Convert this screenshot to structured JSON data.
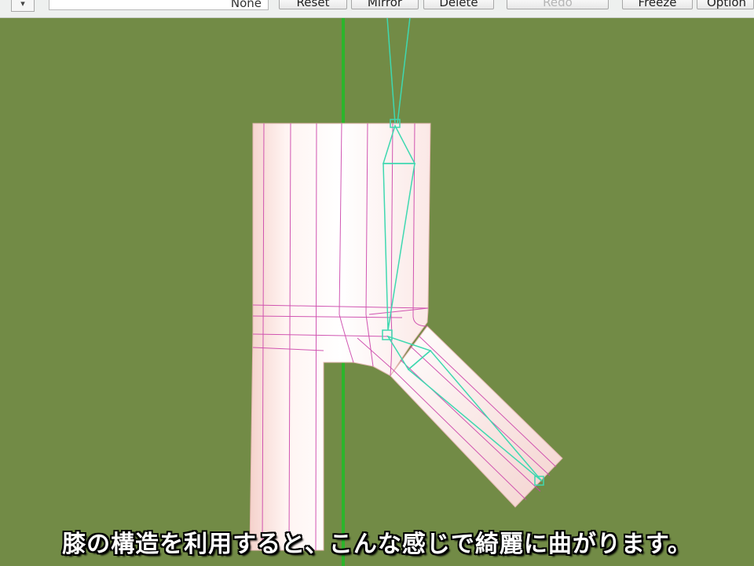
{
  "toolbar": {
    "dropdown_arrow": "▾",
    "field_value": "None",
    "buttons": {
      "reset": "Reset",
      "mirror": "Mirror",
      "delete": "Delete",
      "redo": "Redo",
      "freeze": "Freeze",
      "option": "Option"
    }
  },
  "viewport": {
    "background_color": "#728b46",
    "axis_color": "#2bb52b",
    "mesh_edge_color": "#cc44aa",
    "bone_color": "#3fd8b0"
  },
  "subtitle": "膝の構造を利用すると、こんな感じで綺麗に曲がります。"
}
